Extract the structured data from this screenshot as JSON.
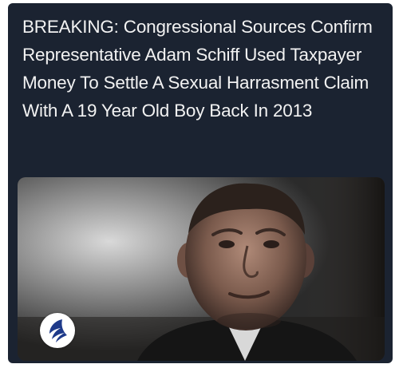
{
  "post": {
    "headline": "BREAKING: Congressional Sources Confirm Representative Adam Schiff Used Taxpayer Money To Settle A Sexual Harrasment Claim With A 19 Year Old Boy Back In 2013"
  },
  "image": {
    "logo_icon": "stylized-eagle-wing-icon"
  },
  "colors": {
    "card_background": "#1b2331",
    "headline_text": "#f2f2f2",
    "logo_background": "#ffffff",
    "logo_mark": "#1e3a8a"
  }
}
